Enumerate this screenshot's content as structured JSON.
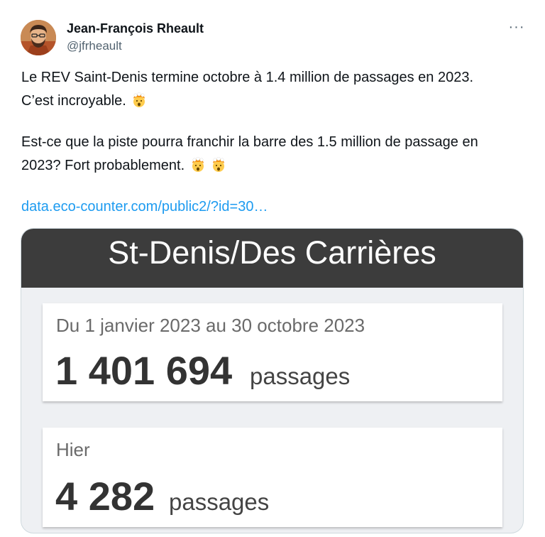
{
  "author": {
    "name": "Jean-François Rheault",
    "handle": "@jfrheault",
    "avatar_icon": "avatar-photo"
  },
  "menu": {
    "more_label": "···"
  },
  "tweet": {
    "line1": "Le REV Saint-Denis termine octobre à 1.4 million de passages en 2023.",
    "line2": "C’est incroyable.",
    "line3": "Est-ce que la piste pourra franchir la barre des 1.5 million de passage en",
    "line4": "2023? Fort probablement.",
    "emoji_icon": "exploding-head-emoji",
    "link": "data.eco-counter.com/public2/?id=30…"
  },
  "media": {
    "title": "St-Denis/Des Carrières",
    "period_card": {
      "period": "Du 1 janvier 2023 au 30 octobre 2023",
      "count": "1 401 694",
      "unit": "passages"
    },
    "yesterday_card": {
      "period": "Hier",
      "count": "4 282",
      "unit": "passages"
    }
  },
  "colors": {
    "link": "#1d9bf0",
    "header_bg": "#3c3c3c",
    "media_bg": "#eef0f3"
  }
}
